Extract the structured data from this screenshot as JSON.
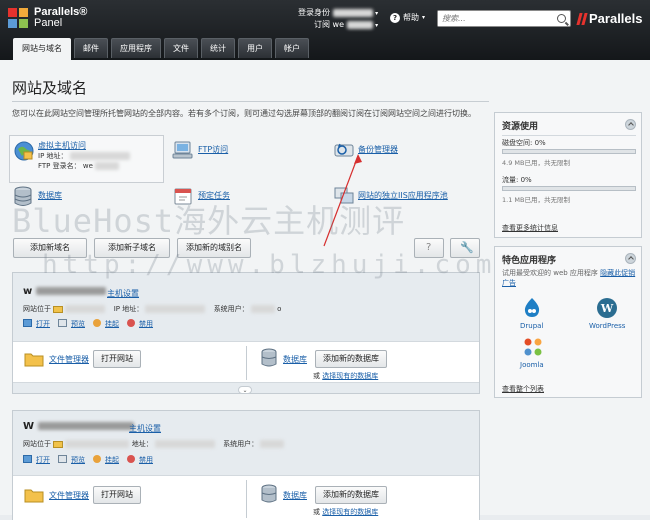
{
  "header": {
    "logo_line1": "Parallels®",
    "logo_line2": "Panel",
    "login_label": "登录身份",
    "subscription_label": "订阅",
    "subscription_value": "we",
    "help_label": "帮助",
    "search_placeholder": "搜索...",
    "brand": "Parallels"
  },
  "tabs": [
    "网站与域名",
    "邮件",
    "应用程序",
    "文件",
    "统计",
    "用户",
    "帐户"
  ],
  "page": {
    "title": "网站及域名",
    "intro": "您可以在此网站空间管理所托管网站的全部内容。若有多个订阅，则可通过勾选屏幕顶部的翻阅订阅在订阅网站空间之间进行切换。"
  },
  "tools": {
    "virtual_host": "虚拟主机访问",
    "ip_label": "IP 地址：",
    "ftp_label": "FTP 登录名：",
    "ftp_value": "we",
    "ftp_access": "FTP访问",
    "backup": "备份管理器",
    "database": "数据库",
    "scheduled_tasks": "预定任务",
    "iis_pool": "网站的独立IIS应用程序池"
  },
  "buttons": {
    "add_domain": "添加新域名",
    "add_subdomain": "添加新子域名",
    "add_alias": "添加新的域别名"
  },
  "sites": [
    {
      "name": "w",
      "host_settings": "主机设置",
      "site_at": "网站位于",
      "ip_label": "IP 地址：",
      "sys_user": "系统用户：",
      "sys_user_suffix": "o",
      "actions": [
        "打开",
        "预览",
        "挂起",
        "禁用"
      ],
      "file_manager": "文件管理器",
      "open_site": "打开网站",
      "database": "数据库",
      "add_database": "添加新的数据库",
      "or": "或",
      "select_existing": "选择现有的数据库"
    },
    {
      "name": "W",
      "host_settings": "主机设置",
      "site_at": "网站位于",
      "ip_label": "地址：",
      "sys_user": "系统用户：",
      "sys_user_suffix": "",
      "actions": [
        "打开",
        "预览",
        "挂起",
        "禁用"
      ],
      "file_manager": "文件管理器",
      "open_site": "打开网站",
      "database": "数据库",
      "add_database": "添加新的数据库",
      "or": "或",
      "select_existing": "选择现有的数据库"
    }
  ],
  "sidebar": {
    "resource_title": "资源使用",
    "disk_label": "磁盘空间: 0%",
    "disk_used": 0,
    "disk_detail": "4.9 MB已用，共无限制",
    "traffic_label": "流量: 0%",
    "traffic_used": 0,
    "traffic_detail": "1.1 MB已用，共无限制",
    "more_stats": "查看更多统计信息",
    "apps_title": "特色应用程序",
    "apps_desc_prefix": "试用最受欢迎的 web 应用程序",
    "apps_desc_link": "隐藏此促销广告",
    "apps": [
      "Drupal",
      "WordPress",
      "Joomla"
    ],
    "all_apps": "查看整个列表"
  },
  "watermarks": {
    "line1": "BlueHost海外云主机测评",
    "line2": "http://www.blzhuji.com"
  },
  "colors": {
    "accent": "#1a5fa8",
    "brand_red": "#e5322d",
    "header_dark": "#1c1f22"
  }
}
